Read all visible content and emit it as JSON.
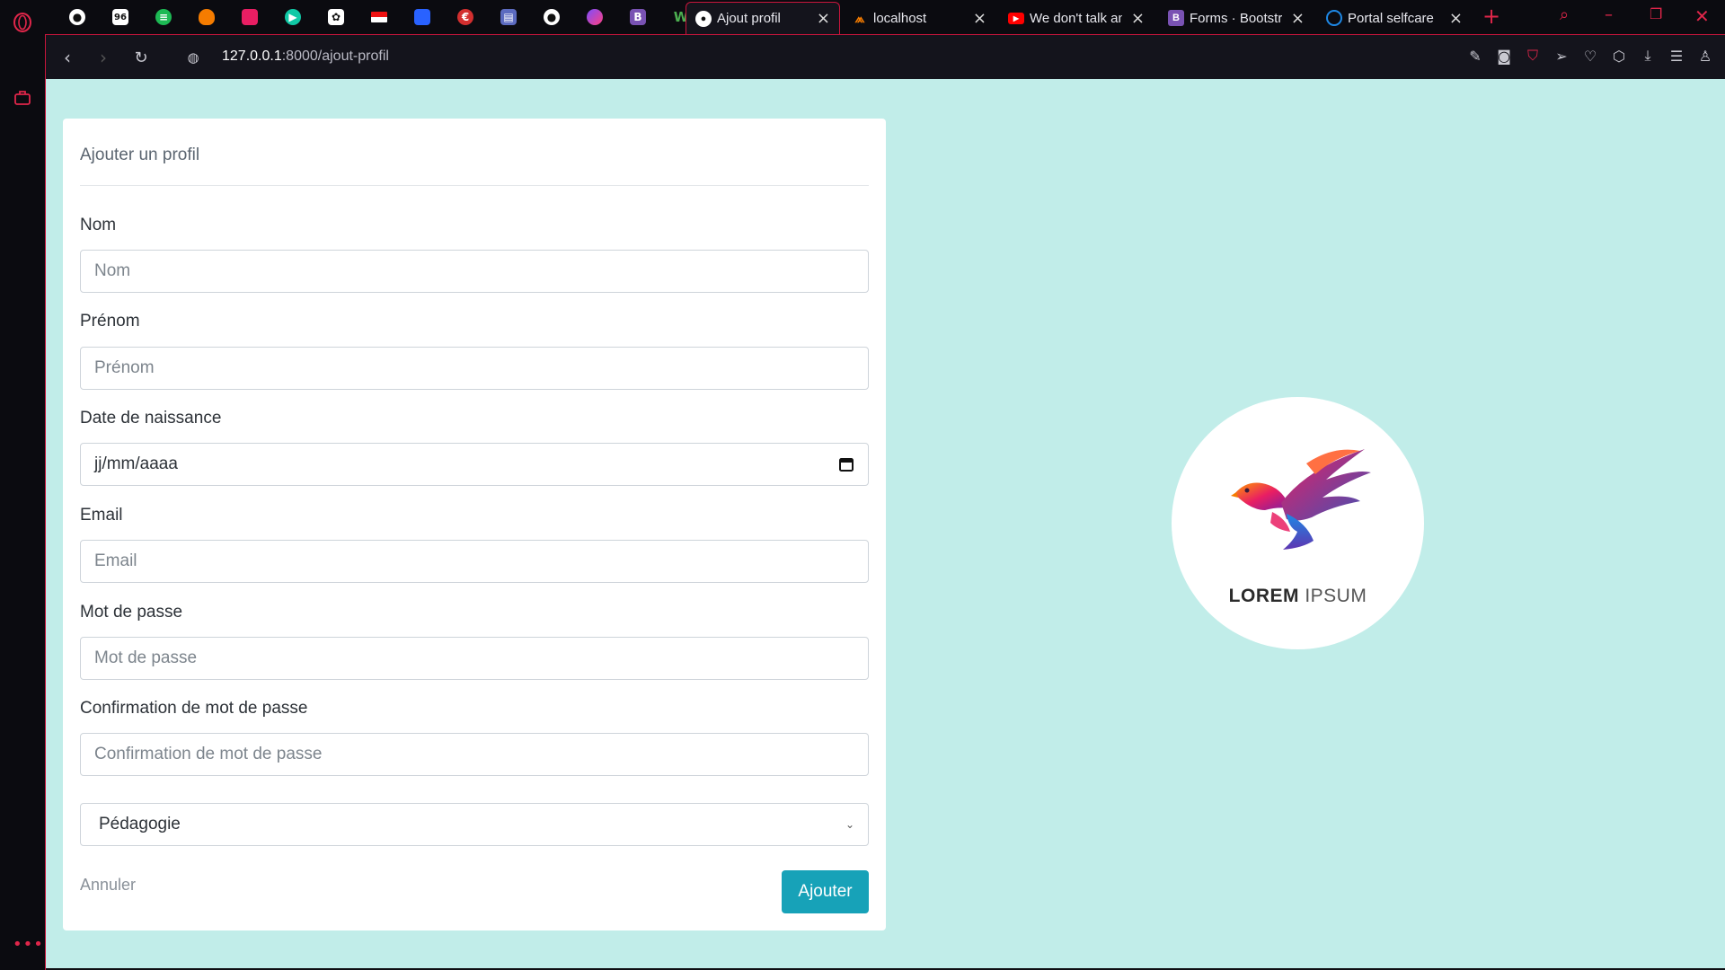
{
  "browser": {
    "tabs": [
      {
        "title": "Ajout profil",
        "active": true,
        "icon": "globe-icon"
      },
      {
        "title": "localhost",
        "active": false,
        "icon": "xampp-icon"
      },
      {
        "title": "We don't talk an",
        "active": false,
        "icon": "youtube-icon"
      },
      {
        "title": "Forms · Bootstra",
        "active": false,
        "icon": "bootstrap-icon"
      },
      {
        "title": "Portal selfcare",
        "active": false,
        "icon": "portal-icon"
      }
    ],
    "url_host": "127.0.0.1",
    "url_path": ":8000/ajout-profil",
    "accent_color": "#e0264a"
  },
  "form": {
    "title": "Ajouter un profil",
    "fields": [
      {
        "label": "Nom",
        "placeholder": "Nom"
      },
      {
        "label": "Prénom",
        "placeholder": "Prénom"
      },
      {
        "label": "Date de naissance",
        "placeholder": "jj/mm/aaaa"
      },
      {
        "label": "Email",
        "placeholder": "Email"
      },
      {
        "label": "Mot de passe",
        "placeholder": "Mot de passe"
      },
      {
        "label": "Confirmation de mot de passe",
        "placeholder": "Confirmation de mot de passe"
      }
    ],
    "select_value": "Pédagogie",
    "cancel_label": "Annuler",
    "submit_label": "Ajouter",
    "submit_color": "#17a2b8"
  },
  "logo": {
    "word_bold": "LOREM",
    "word_light": "IPSUM"
  },
  "page_background": "#c1ede9"
}
